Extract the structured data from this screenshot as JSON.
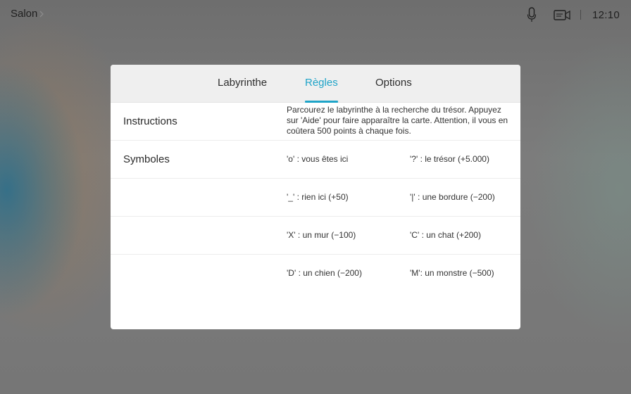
{
  "topbar": {
    "room_name": "Salon",
    "clock": "12:10",
    "icons": [
      "chevron-right-icon",
      "microphone-icon",
      "video-call-icon"
    ]
  },
  "dialog": {
    "tabs": [
      {
        "label": "Labyrinthe",
        "active": false
      },
      {
        "label": "Règles",
        "active": true
      },
      {
        "label": "Options",
        "active": false
      }
    ],
    "accent_color": "#1fa4c8",
    "instructions": {
      "label": "Instructions",
      "text": "Parcourez le labyrinthe à la recherche du trésor. Appuyez sur 'Aide' pour faire apparaître la carte. Attention, il vous en coûtera 500 points à chaque fois."
    },
    "symbols": {
      "label": "Symboles",
      "rows": [
        [
          "'o' : vous êtes ici",
          "'?' : le trésor (+5.000)"
        ],
        [
          "'_' : rien ici (+50)",
          "'|' : une bordure (−200)"
        ],
        [
          "'X' : un mur (−100)",
          "'C' : un chat (+200)"
        ],
        [
          "'D' : un chien (−200)",
          "'M': un monstre (−500)"
        ]
      ]
    }
  }
}
